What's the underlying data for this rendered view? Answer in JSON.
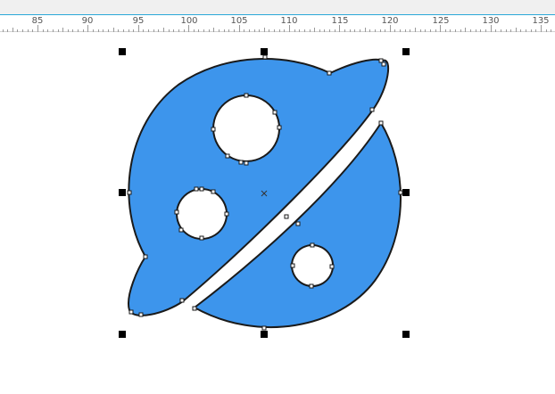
{
  "ruler": {
    "labels": [
      "85",
      "90",
      "95",
      "100",
      "105",
      "110",
      "115",
      "120",
      "125",
      "130",
      "135"
    ]
  },
  "colors": {
    "shape_fill": "#3d95ec",
    "shape_stroke": "#1a1a1a",
    "ruler_accent": "#2aa7d8"
  },
  "icons": [
    "selection-handle",
    "node-handle",
    "center-marker",
    "planet-shape"
  ]
}
